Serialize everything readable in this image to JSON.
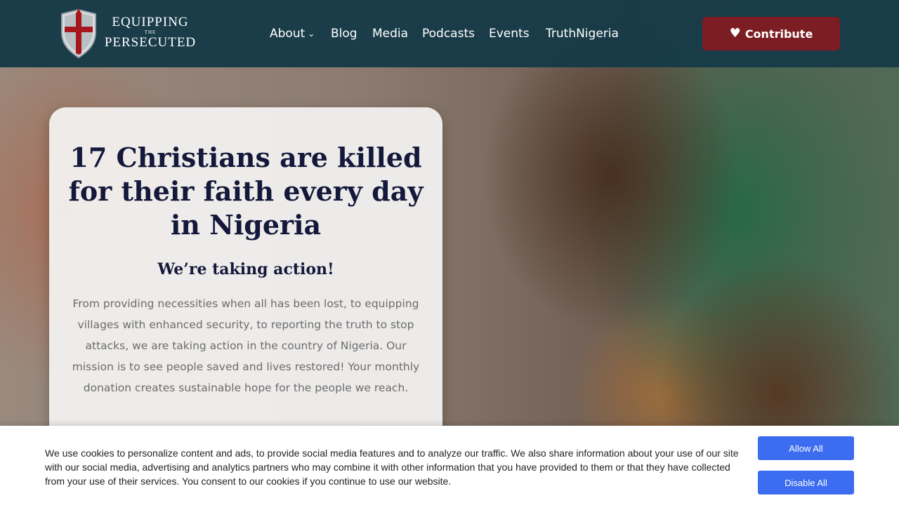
{
  "logo": {
    "line1": "EQUIPPING",
    "line2": "THE",
    "line3": "PERSECUTED",
    "icon": "shield-cross-icon"
  },
  "nav": {
    "items": [
      {
        "label": "About",
        "has_dropdown": true
      },
      {
        "label": "Blog"
      },
      {
        "label": "Media"
      },
      {
        "label": "Podcasts"
      },
      {
        "label": "Events"
      },
      {
        "label": "TruthNigeria"
      }
    ],
    "dropdown_icon": "chevron-down-icon"
  },
  "contribute": {
    "label": "Contribute",
    "icon": "heart-icon",
    "color": "#7b1d22"
  },
  "hero": {
    "headline": "17 Christians are killed for their faith every day in Nigeria",
    "subhead": "We’re taking action!",
    "body": "From providing necessities when all has been lost, to equipping villages with enhanced security, to reporting the truth to stop attacks, we are taking action in the country of Nigeria. Our mission is to see people saved and lives restored! Your monthly donation creates sustainable hope for the people we reach."
  },
  "cookie_banner": {
    "text": "We use cookies to personalize content and ads, to provide social media features and to analyze our traffic. We also share information about your use of our site with our social media, advertising and analytics partners who may combine it with other information that you have provided to them or that they have collected from your use of their services. You consent to our cookies if you continue to use our website.",
    "allow_label": "Allow All",
    "disable_label": "Disable All",
    "button_color": "#3c6df0"
  },
  "colors": {
    "header_bg": "#163a48",
    "headline": "#14183a"
  }
}
